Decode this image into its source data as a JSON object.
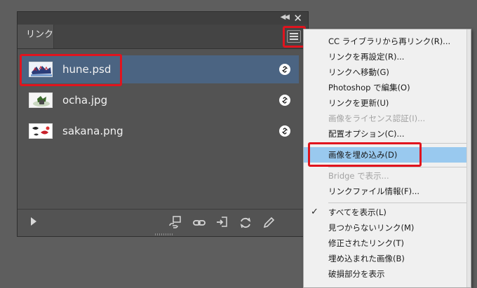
{
  "panel": {
    "tab_label": "リンク",
    "items": [
      {
        "name": "hune.psd",
        "selected": true
      },
      {
        "name": "ocha.jpg",
        "selected": false
      },
      {
        "name": "sakana.png",
        "selected": false
      }
    ],
    "icons": {
      "collapse": "double-chevron-left-icon",
      "close": "close-icon",
      "menu": "hamburger-menu-icon",
      "link": "link-icon",
      "toolbar": [
        "relink-cc-icon",
        "relink-icon",
        "go-to-link-icon",
        "update-link-icon",
        "edit-original-icon"
      ]
    }
  },
  "menu": {
    "items": [
      {
        "label": "CC ライブラリから再リンク(R)...",
        "state": "normal"
      },
      {
        "label": "リンクを再設定(R)...",
        "state": "normal"
      },
      {
        "label": "リンクへ移動(G)",
        "state": "normal"
      },
      {
        "label": "Photoshop で編集(O)",
        "state": "normal"
      },
      {
        "label": "リンクを更新(U)",
        "state": "normal"
      },
      {
        "label": "画像をライセンス認証(I)...",
        "state": "disabled"
      },
      {
        "label": "配置オプション(C)...",
        "state": "normal"
      },
      {
        "label": "画像を埋め込み(D)",
        "state": "highlight"
      },
      {
        "label": "Bridge で表示...",
        "state": "disabled"
      },
      {
        "label": "リンクファイル情報(F)...",
        "state": "normal"
      },
      {
        "label": "すべてを表示(L)",
        "state": "checked"
      },
      {
        "label": "見つからないリンク(M)",
        "state": "normal"
      },
      {
        "label": "修正されたリンク(T)",
        "state": "normal"
      },
      {
        "label": "埋め込まれた画像(B)",
        "state": "normal"
      },
      {
        "label": "破損部分を表示",
        "state": "normal"
      }
    ]
  },
  "colors": {
    "selection": "#4b6482",
    "highlight": "#99c9ef",
    "annotation": "#e0141e"
  }
}
